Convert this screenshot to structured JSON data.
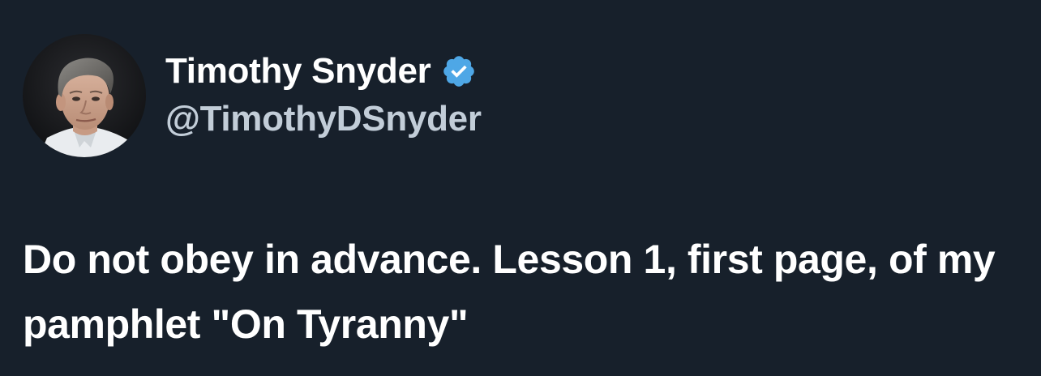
{
  "tweet": {
    "author": {
      "display_name": "Timothy Snyder",
      "handle": "@TimothyDSnyder",
      "verified": true,
      "avatar": "profile-photo"
    },
    "text": "Do not obey in advance. Lesson 1, first page, of my pamphlet \"On Tyranny\""
  },
  "colors": {
    "background": "#17202b",
    "name": "#ffffff",
    "handle": "#c2cdd8",
    "verified_badge": "#4ea7e6",
    "text": "#ffffff"
  },
  "icons": {
    "verified": "verified-badge-icon"
  }
}
